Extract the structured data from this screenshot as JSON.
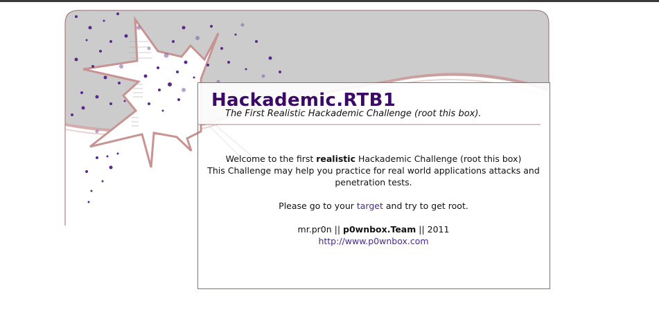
{
  "header": {
    "title": "Hackademic.RTB1",
    "subtitle": "The First Realistic Hackademic Challenge (root this box)."
  },
  "main": {
    "welcome_pre": "Welcome to the first ",
    "welcome_bold": "realistic",
    "welcome_post": " Hackademic Challenge (root this box)",
    "line2": "This Challenge may help you practice for real world applications attacks and",
    "line3": "penetration tests.",
    "goto_pre": "Please go to your ",
    "goto_link": "target",
    "goto_post": " and try to get root.",
    "credit_author": "mr.pr0n || ",
    "credit_team": "p0wnbox.Team",
    "credit_year": " || 2011",
    "url": "http://www.p0wnbox.com"
  },
  "colors": {
    "title": "#3b0a66",
    "link": "#4a2a88",
    "header_gray": "#cccccc",
    "border_rose": "#c89090"
  }
}
